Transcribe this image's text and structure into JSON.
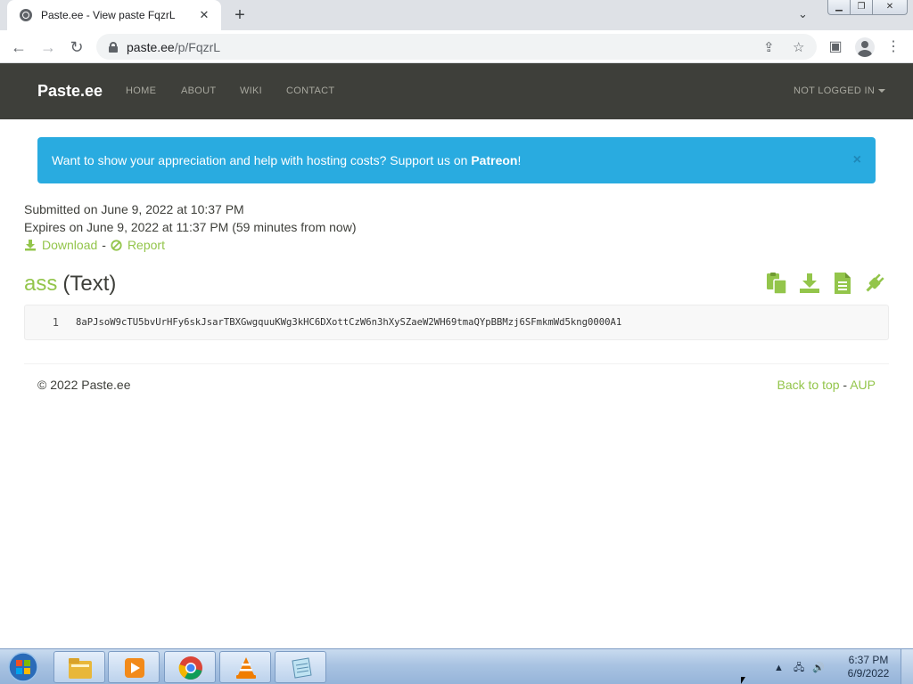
{
  "browser": {
    "tab_title": "Paste.ee - View paste FqzrL",
    "tab_close": "✕",
    "new_tab": "+",
    "url_host": "paste.ee",
    "url_path": "/p/FqzrL"
  },
  "site": {
    "brand": "Paste.ee",
    "nav": [
      "HOME",
      "ABOUT",
      "WIKI",
      "CONTACT"
    ],
    "login": "NOT LOGGED IN",
    "alert": {
      "text": "Want to show your appreciation and help with hosting costs? Support us on ",
      "link": "Patreon",
      "suffix": "!",
      "close": "×"
    },
    "meta": {
      "submitted": "Submitted on June 9, 2022 at 10:37 PM",
      "expires": "Expires on June 9, 2022 at 11:37 PM (59 minutes from now)",
      "download": "Download",
      "separator": "-",
      "report": "Report"
    },
    "paste": {
      "name": "ass",
      "language": "(Text)",
      "line_number": "1",
      "content": "8aPJsoW9cTU5bvUrHFy6skJsarTBXGwgquuKWg3kHC6DXottCzW6n3hXySZaeW2WH69tmaQYpBBMzj6SFmkmWd5kng0000A1"
    },
    "footer": {
      "copyright": "© 2022 Paste.ee",
      "back_to_top": "Back to top",
      "separator": " - ",
      "aup": "AUP"
    },
    "accent_color": "#93c54b",
    "alert_color": "#29abe0",
    "navbar_color": "#3e3f3a"
  },
  "taskbar": {
    "time": "6:37 PM",
    "date": "6/9/2022",
    "apps": [
      "file-explorer-icon",
      "media-player-icon",
      "chrome-icon",
      "vlc-icon",
      "notepad-icon"
    ]
  }
}
